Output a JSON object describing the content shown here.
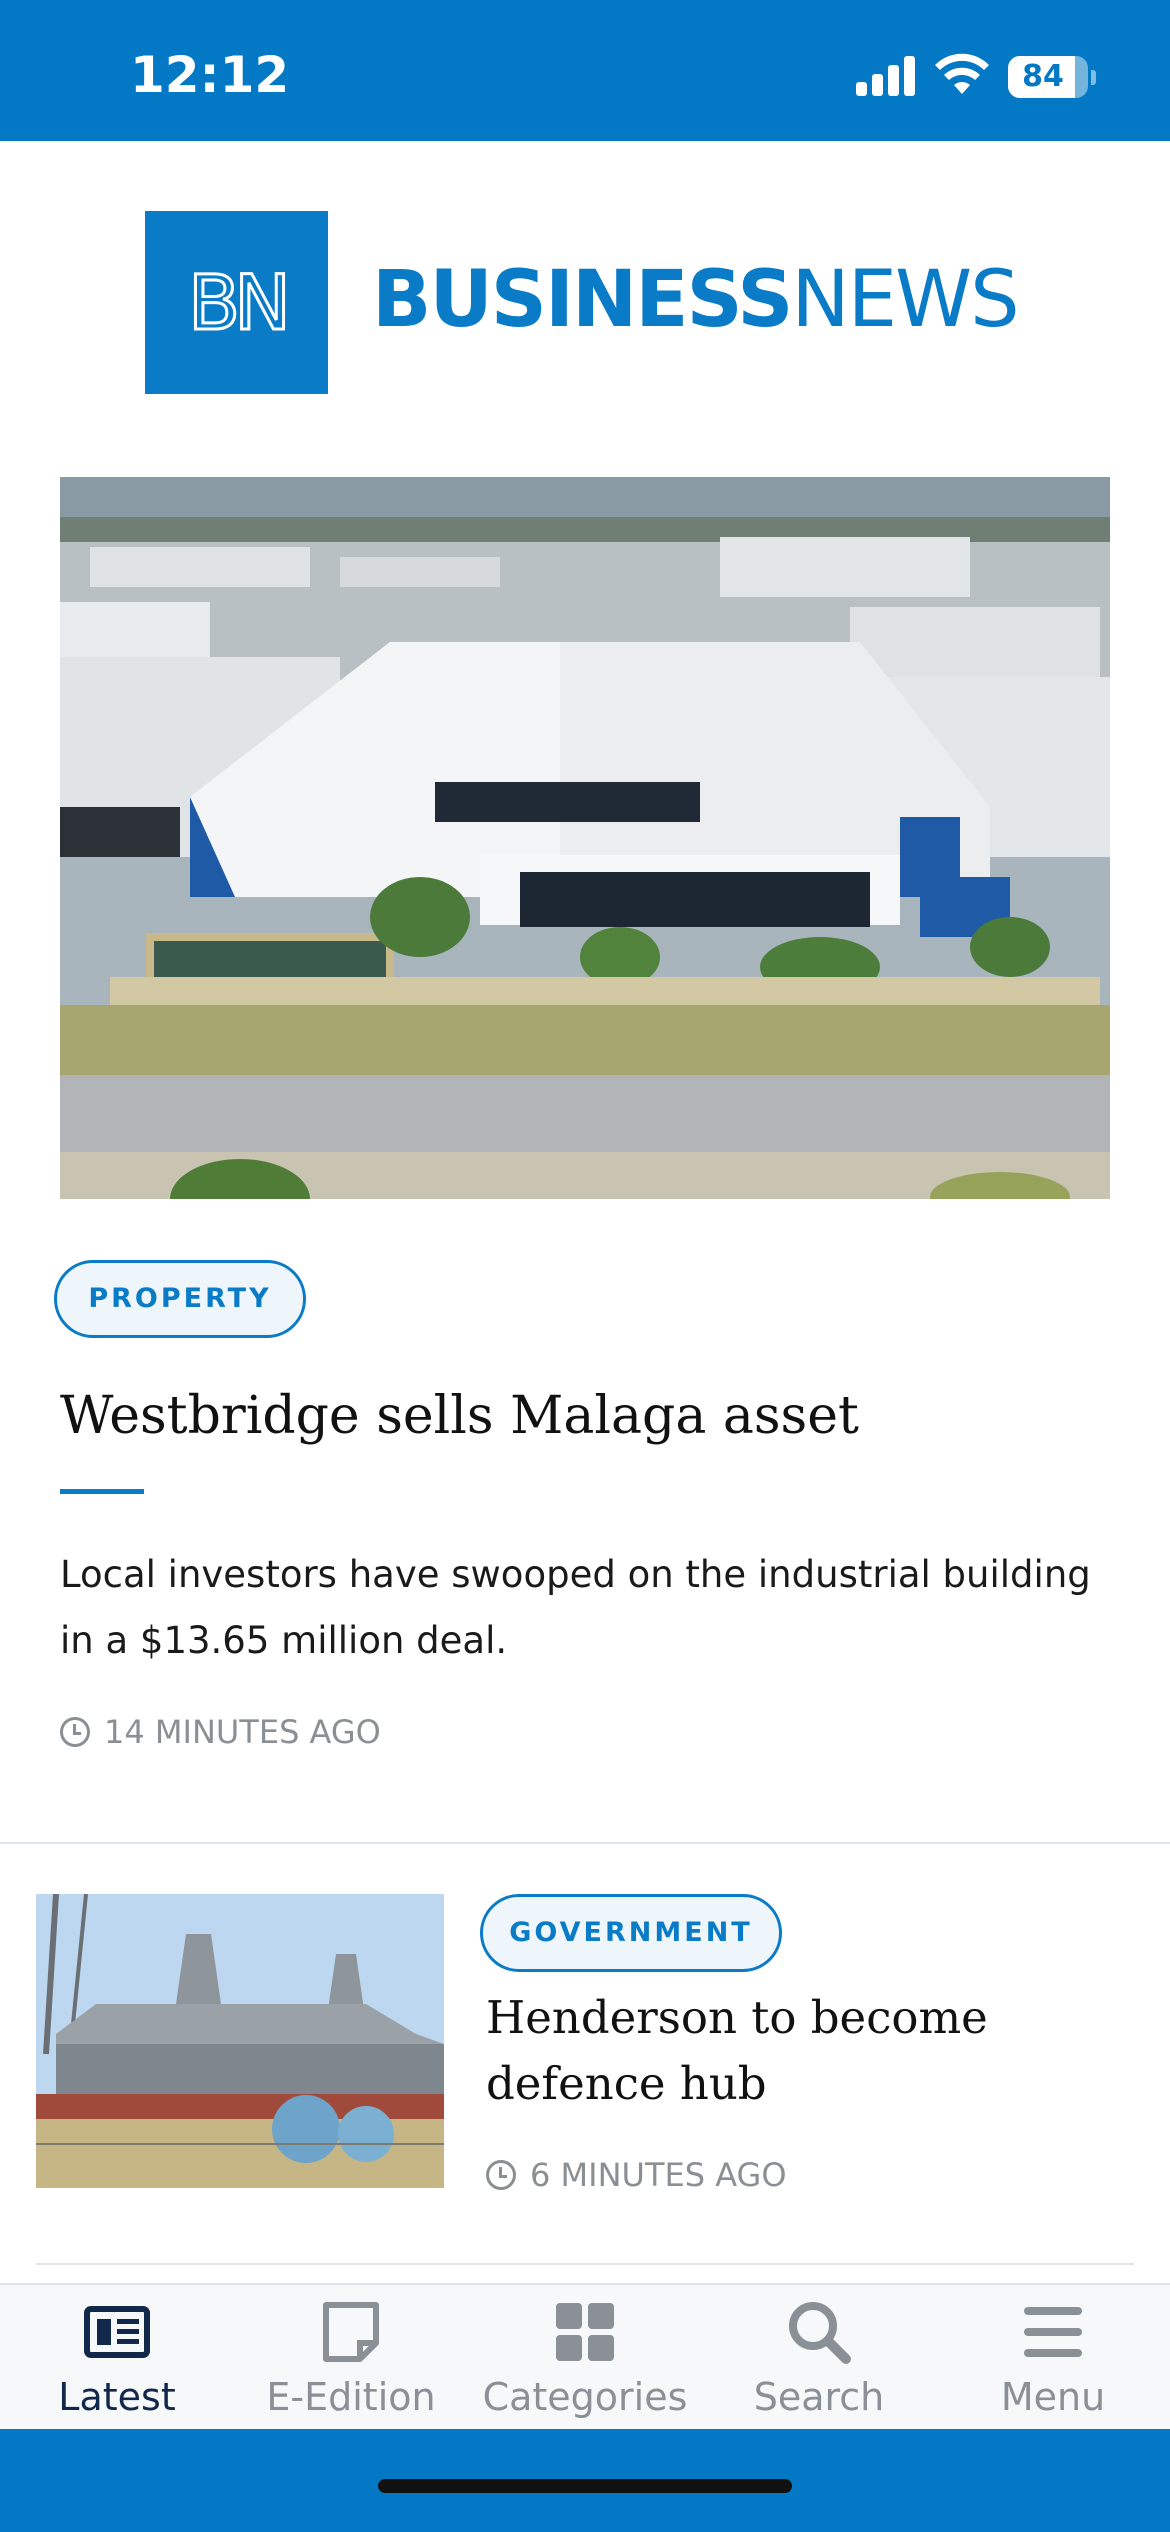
{
  "status_bar": {
    "time": "12:12",
    "battery": "84",
    "battery_level": 0.84
  },
  "logo": {
    "mark": "BN",
    "word_bold": "BUSINESS",
    "word_light": "NEWS"
  },
  "featured_article": {
    "category": "PROPERTY",
    "headline": "Westbridge sells Malaga asset",
    "summary": "Local investors have swooped on the industrial building in a $13.65 million deal.",
    "timestamp": "14 MINUTES AGO"
  },
  "articles": [
    {
      "category": "GOVERNMENT",
      "headline": "Henderson to become defence hub",
      "timestamp": "6 MINUTES AGO"
    }
  ],
  "tab_bar": {
    "tabs": [
      {
        "label": "Latest",
        "icon": "newspaper-icon",
        "active": true
      },
      {
        "label": "E-Edition",
        "icon": "document-icon",
        "active": false
      },
      {
        "label": "Categories",
        "icon": "grid-icon",
        "active": false
      },
      {
        "label": "Search",
        "icon": "search-icon",
        "active": false
      },
      {
        "label": "Menu",
        "icon": "hamburger-menu-icon",
        "active": false
      }
    ]
  },
  "colors": {
    "brand_blue": "#0378c4",
    "accent_blue": "#0a7bc6",
    "active_tab": "#11284b",
    "inactive_tab": "#8a9096"
  }
}
